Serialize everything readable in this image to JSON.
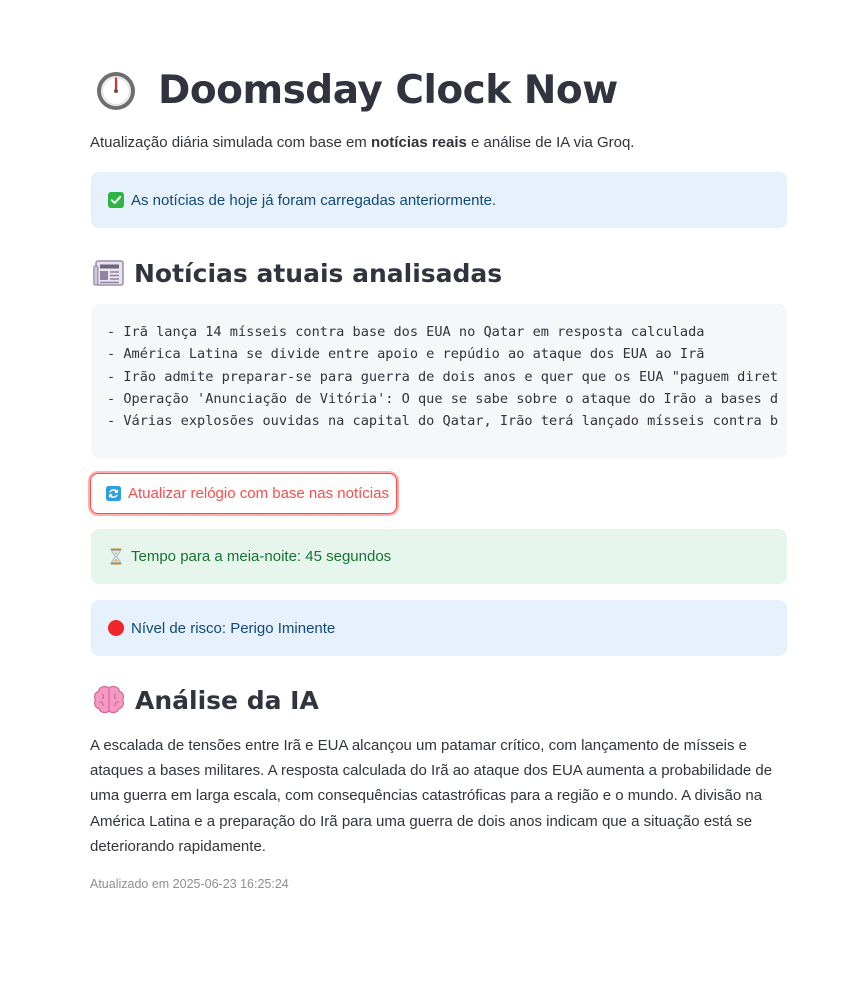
{
  "header": {
    "title": "Doomsday Clock Now",
    "title_icon": "stopwatch-icon"
  },
  "subtitle": {
    "before": "Atualização diária simulada com base em ",
    "bold": "notícias reais",
    "after": " e análise de IA via Groq."
  },
  "status": {
    "loaded_icon": "check-mark-icon",
    "loaded_message": "As notícias de hoje já foram carregadas anteriormente."
  },
  "news_section": {
    "icon": "newspaper-icon",
    "heading": "Notícias atuais analisadas",
    "lines": [
      "- Irã lança 14 mísseis contra base dos EUA no Qatar em resposta calculada",
      "- América Latina se divide entre apoio e repúdio ao ataque dos EUA ao Irã",
      "- Irão admite preparar-se para guerra de dois anos e quer que os EUA \"paguem diret",
      "- Operação 'Anunciação de Vitória': O que se sabe sobre o ataque do Irão a bases d",
      "- Várias explosões ouvidas na capital do Qatar, Irão terá lançado mísseis contra b"
    ]
  },
  "update_button": {
    "icon": "refresh-icon",
    "label": "Atualizar relógio com base nas notícias"
  },
  "time_alert": {
    "icon": "hourglass-icon",
    "text": "Tempo para a meia-noite: 45 segundos"
  },
  "risk_alert": {
    "icon": "red-circle-icon",
    "text": "Nível de risco: Perigo Iminente"
  },
  "ai_section": {
    "icon": "brain-icon",
    "heading": "Análise da IA",
    "body": "A escalada de tensões entre Irã e EUA alcançou um patamar crítico, com lançamento de mísseis e ataques a bases militares. A resposta calculada do Irã ao ataque dos EUA aumenta a probabilidade de uma guerra em larga escala, com consequências catastróficas para a região e o mundo. A divisão na América Latina e a preparação do Irã para uma guerra de dois anos indicam que a situação está se deteriorando rapidamente."
  },
  "footer": {
    "updated_at": "Atualizado em 2025-06-23 16:25:24"
  },
  "colors": {
    "primary": "#ff4b4b",
    "info_bg": "#e6f1fb",
    "info_text": "#0f4a7b",
    "success_bg": "#e6f6ec",
    "success_text": "#177233",
    "code_bg": "#f6f7f9",
    "text": "#31333f",
    "caption": "#8d8f98"
  }
}
